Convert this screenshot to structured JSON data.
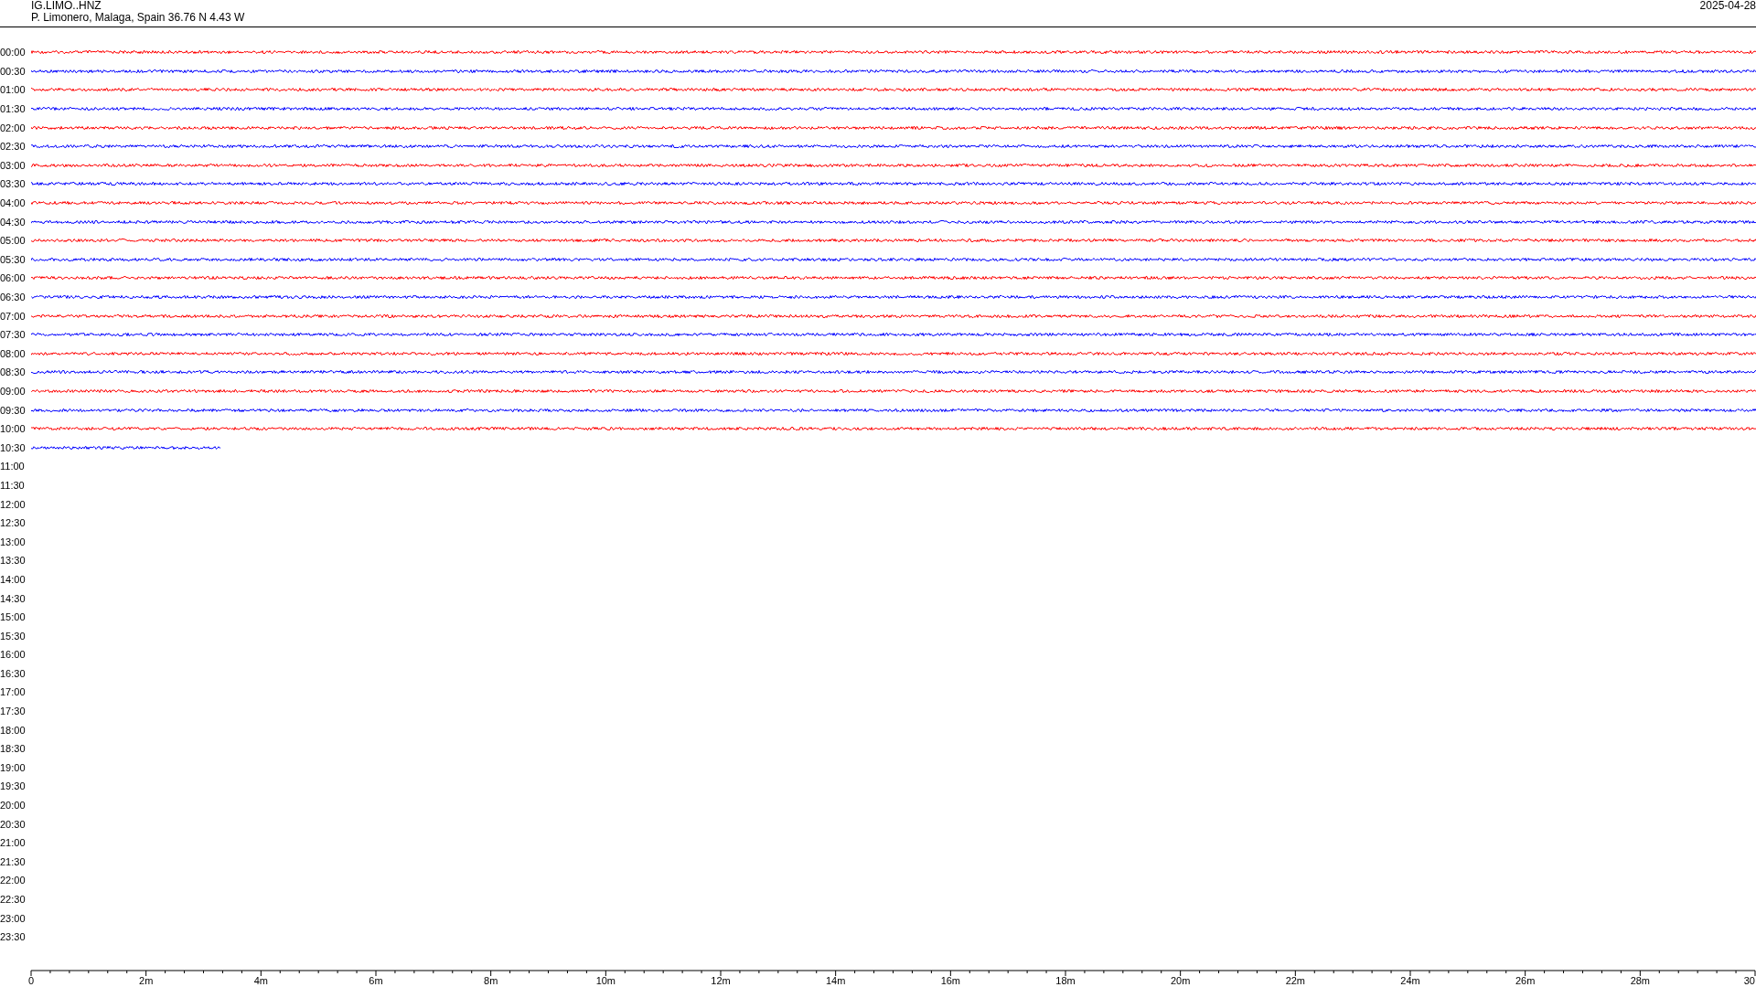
{
  "header": {
    "station": "IG.LIMO..HNZ",
    "location": "P. Limonero, Malaga, Spain  36.76 N 4.43 W",
    "date": "2025-04-28"
  },
  "rows": [
    {
      "time": "00:00",
      "color": "#ff0000",
      "level": 1
    },
    {
      "time": "00:30",
      "color": "#0000ff",
      "level": 1
    },
    {
      "time": "01:00",
      "color": "#ff0000",
      "level": 1
    },
    {
      "time": "01:30",
      "color": "#0000ff",
      "level": 1
    },
    {
      "time": "02:00",
      "color": "#ff0000",
      "level": 1
    },
    {
      "time": "02:30",
      "color": "#0000ff",
      "level": 1
    },
    {
      "time": "03:00",
      "color": "#ff0000",
      "level": 1
    },
    {
      "time": "03:30",
      "color": "#0000ff",
      "level": 1
    },
    {
      "time": "04:00",
      "color": "#ff0000",
      "level": 1
    },
    {
      "time": "04:30",
      "color": "#0000ff",
      "level": 1
    },
    {
      "time": "05:00",
      "color": "#ff0000",
      "level": 1
    },
    {
      "time": "05:30",
      "color": "#0000ff",
      "level": 1
    },
    {
      "time": "06:00",
      "color": "#ff0000",
      "level": 1
    },
    {
      "time": "06:30",
      "color": "#0000ff",
      "level": 1
    },
    {
      "time": "07:00",
      "color": "#ff0000",
      "level": 1
    },
    {
      "time": "07:30",
      "color": "#0000ff",
      "level": 1
    },
    {
      "time": "08:00",
      "color": "#ff0000",
      "level": 1
    },
    {
      "time": "08:30",
      "color": "#0000ff",
      "level": 1
    },
    {
      "time": "09:00",
      "color": "#ff0000",
      "level": 1
    },
    {
      "time": "09:30",
      "color": "#0000ff",
      "level": 1
    },
    {
      "time": "10:00",
      "color": "#ff0000",
      "level": 1
    },
    {
      "time": "10:30",
      "color": "#0000ff",
      "level": 0.11
    },
    {
      "time": "11:00"
    },
    {
      "time": "11:30"
    },
    {
      "time": "12:00"
    },
    {
      "time": "12:30"
    },
    {
      "time": "13:00"
    },
    {
      "time": "13:30"
    },
    {
      "time": "14:00"
    },
    {
      "time": "14:30"
    },
    {
      "time": "15:00"
    },
    {
      "time": "15:30"
    },
    {
      "time": "16:00"
    },
    {
      "time": "16:30"
    },
    {
      "time": "17:00"
    },
    {
      "time": "17:30"
    },
    {
      "time": "18:00"
    },
    {
      "time": "18:30"
    },
    {
      "time": "19:00"
    },
    {
      "time": "19:30"
    },
    {
      "time": "20:00"
    },
    {
      "time": "20:30"
    },
    {
      "time": "21:00"
    },
    {
      "time": "21:30"
    },
    {
      "time": "22:00"
    },
    {
      "time": "22:30"
    },
    {
      "time": "23:00"
    },
    {
      "time": "23:30"
    }
  ],
  "axis": {
    "ticks": [
      "0",
      "2m",
      "4m",
      "6m",
      "8m",
      "10m",
      "12m",
      "14m",
      "16m",
      "18m",
      "20m",
      "22m",
      "24m",
      "26m",
      "28m",
      "30"
    ]
  }
}
